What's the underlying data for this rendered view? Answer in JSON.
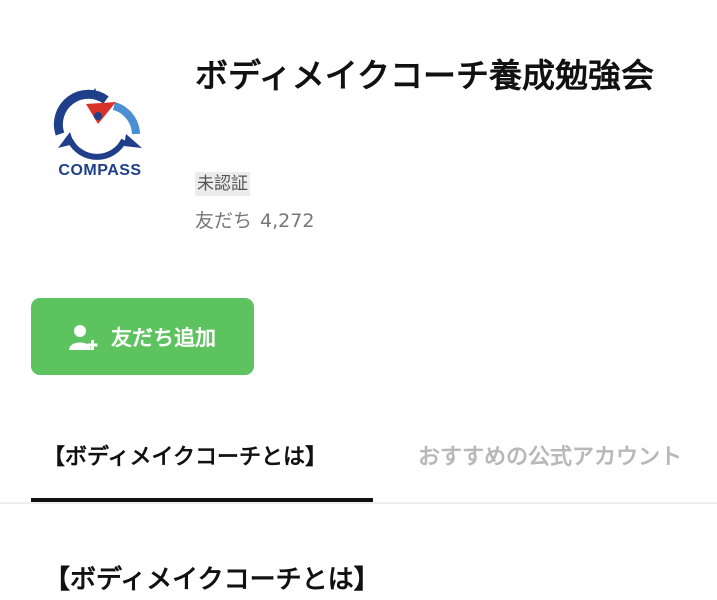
{
  "profile": {
    "logo_text": "COMPASS",
    "name": "ボディメイクコーチ養成勉強会",
    "badge": "未認証",
    "friends_label": "友だち",
    "friends_count": "4,272"
  },
  "actions": {
    "add_friend_label": "友だち追加",
    "add_friend_icon": "user-plus-icon"
  },
  "tabs": [
    {
      "label": "【ボディメイクコーチとは】",
      "active": true
    },
    {
      "label": "おすすめの公式アカウント"
    }
  ],
  "content": {
    "section_title": "【ボディメイクコーチとは】"
  },
  "colors": {
    "accent_green": "#5cc35f",
    "logo_blue": "#1f3f8a",
    "logo_light_blue": "#4a8fd4",
    "logo_red": "#d8332b",
    "text_dark": "#111111",
    "text_muted": "#777777",
    "tab_inactive": "#b8b8b8"
  }
}
